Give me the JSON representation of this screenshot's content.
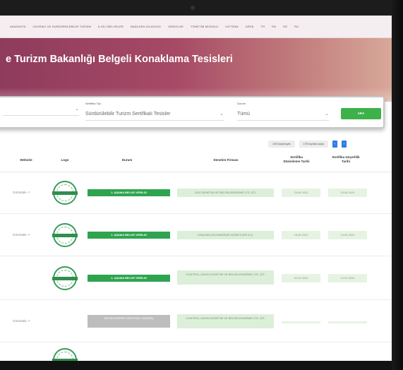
{
  "nav": {
    "items": [
      "ANASAYFA",
      "GÜVENLİ VE SÜRDÜRÜLEBİLİR TURİZM",
      "İLGİLİ BELGELER",
      "BAŞVURU KILAVUZU",
      "VİDEOLAR",
      "YÖNETİM MODÜLÜ",
      "İLETİŞİM",
      "GİRİŞ",
      "TR",
      "EN",
      "DE",
      "RU"
    ]
  },
  "hero": {
    "title": "e Turizm Bakanlığı Belgeli Konaklama Tesisleri"
  },
  "filters": {
    "certificate_type_label": "Sertifika Tipi",
    "certificate_type_value": "Sürdürülebilir Turizm Sertifikalı Tesisler",
    "status_label": "Durum",
    "status_value": "Tümü",
    "search_label": "ARA"
  },
  "toolbar": {
    "per_page": "1000 kayıt/sayfa",
    "total": "1/78 kayıttan sayfa",
    "prev": "‹",
    "next": "›"
  },
  "table": {
    "headers": {
      "website": "Website",
      "logo": "Logo",
      "status": "Durum",
      "audit_firm": "Denetim Firması",
      "issue_date": "Sertifika Düzenleme Tarihi",
      "expiry_date": "Sertifika Geçerlilik Tarihi"
    },
    "rows": [
      {
        "website": "Görüntüle ↗",
        "status": "1. AŞAMA BELGE VERİLDİ",
        "firm": "DGS DENETİM VE BELGELENDİRME LTD. ŞTİ.",
        "issue": "25.06.2023",
        "expiry": "25.06.2024"
      },
      {
        "website": "Görüntüle ↗",
        "status": "1. AŞAMA BELGE VERİLDİ",
        "firm": "KIWA BELGELENDİRME HİZMETLERİ A.Ş.",
        "issue": "16.05.2023",
        "expiry": "16.05.2024"
      },
      {
        "website": "",
        "status": "1. AŞAMA BELGE VERİLDİ",
        "firm": "CONTROL UNION GÖZETİM VE BELGELENDİRME LTD. ŞTİ.",
        "issue": "30.03.2023",
        "expiry": "23.03.2024"
      },
      {
        "website": "Görüntüle ↗",
        "status": "BELGELENDİRME SÜRECİNDE (TAŞARIM)",
        "firm": "CONTROL UNION GÖZETİM VE BELGELENDİRME LTD. ŞTİ.",
        "issue": "",
        "expiry": ""
      }
    ]
  }
}
